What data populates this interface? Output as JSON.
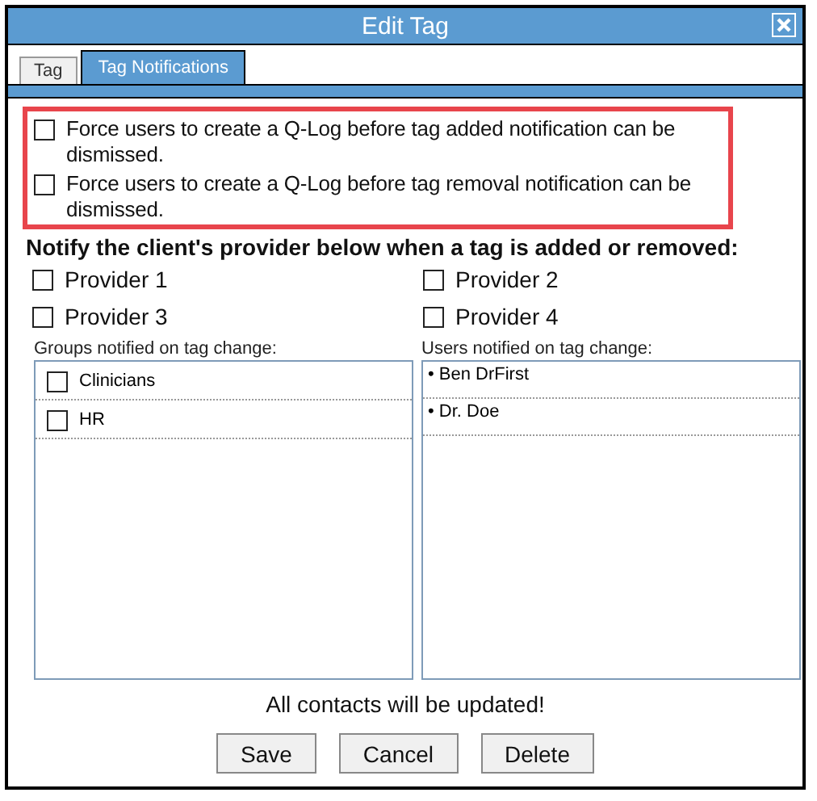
{
  "window": {
    "title": "Edit Tag"
  },
  "tabs": [
    {
      "label": "Tag",
      "selected": false
    },
    {
      "label": "Tag Notifications",
      "selected": true
    }
  ],
  "force_options": [
    {
      "label": "Force users to create a Q-Log before tag added notification can be dismissed.",
      "checked": false
    },
    {
      "label": "Force users to create a Q-Log before tag removal notification can be dismissed.",
      "checked": false
    }
  ],
  "providers_heading": "Notify the client's provider below when a tag is added or removed:",
  "providers": [
    {
      "label": "Provider 1",
      "checked": false
    },
    {
      "label": "Provider 2",
      "checked": false
    },
    {
      "label": "Provider 3",
      "checked": false
    },
    {
      "label": "Provider 4",
      "checked": false
    }
  ],
  "groups": {
    "label": "Groups notified on tag change:",
    "items": [
      {
        "label": "Clinicians",
        "checked": false
      },
      {
        "label": "HR",
        "checked": false
      }
    ]
  },
  "users": {
    "label": "Users notified on tag change:",
    "items": [
      "• Ben DrFirst",
      "• Dr. Doe"
    ]
  },
  "message": "All contacts will be updated!",
  "buttons": [
    "Save",
    "Cancel",
    "Delete"
  ]
}
